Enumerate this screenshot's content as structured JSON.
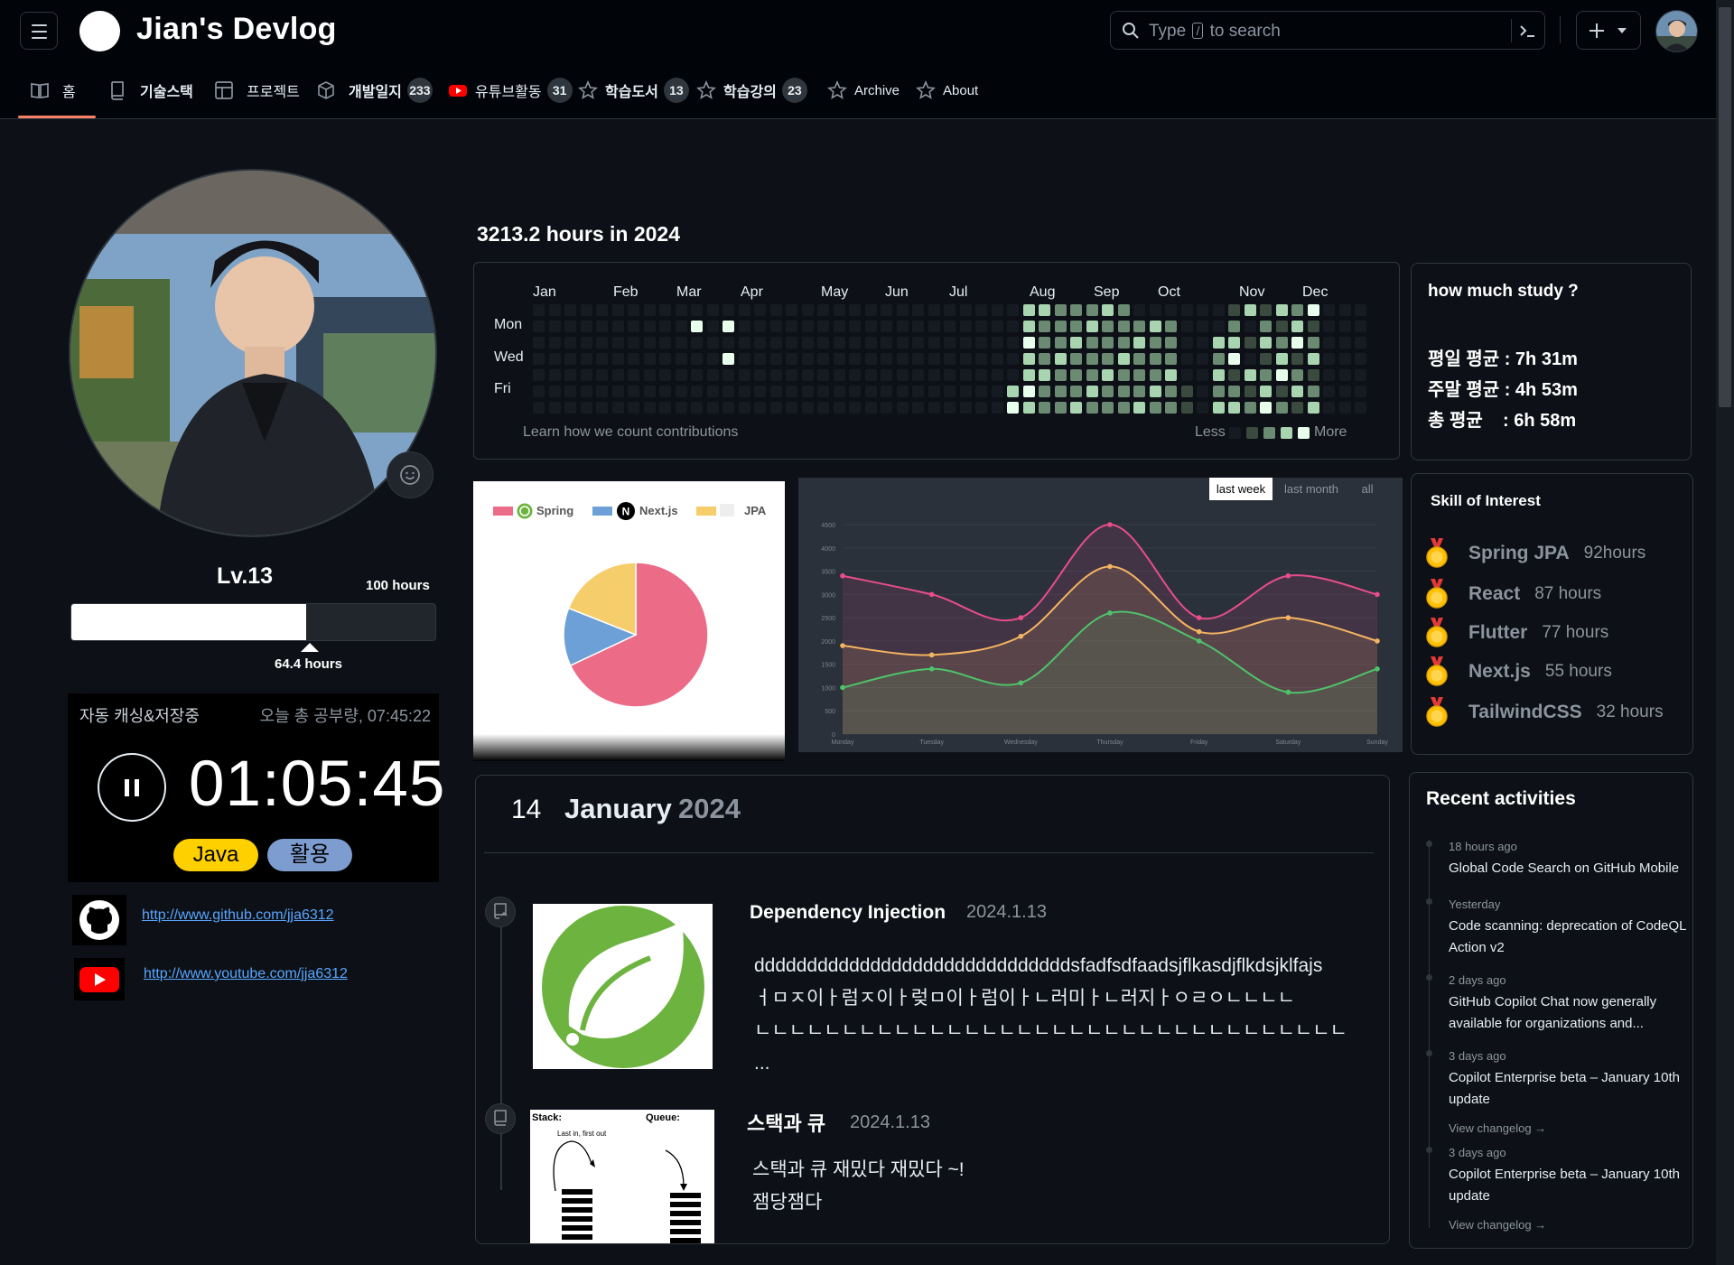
{
  "header": {
    "site_title": "Jian's Devlog",
    "search_placeholder_before": "Type",
    "search_placeholder_key": "/",
    "search_placeholder_after": "to search"
  },
  "nav": [
    {
      "label": "홈",
      "icon": "book-icon"
    },
    {
      "label": "기술스택",
      "icon": "repo-icon"
    },
    {
      "label": "프로젝트",
      "icon": "table-icon"
    },
    {
      "label": "개발일지",
      "icon": "package-icon",
      "count": "233"
    },
    {
      "label": "유튜브활동",
      "icon": "youtube-icon",
      "count": "31"
    },
    {
      "label": "학습도서",
      "icon": "star-icon",
      "count": "13"
    },
    {
      "label": "학습강의",
      "icon": "star-icon",
      "count": "23"
    },
    {
      "label": "Archive",
      "icon": "star-icon"
    },
    {
      "label": "About",
      "icon": "star-icon"
    }
  ],
  "profile": {
    "level": "Lv.13",
    "goal_label": "100 hours",
    "progress_fraction": 0.644,
    "progress_label": "64.4 hours"
  },
  "timer": {
    "autosave_label": "자동 캐싱&저장중",
    "today_total": "오늘 총 공부량, 07:45:22",
    "elapsed": "01:05:45",
    "tags": [
      "Java",
      "활용"
    ]
  },
  "links": {
    "github": "http://www.github.com/jja6312",
    "youtube": "http://www.youtube.com/jja6312"
  },
  "contributions": {
    "title": "3213.2 hours in 2024",
    "months": [
      "Jan",
      "Feb",
      "Mar",
      "Apr",
      "May",
      "Jun",
      "Jul",
      "Aug",
      "Sep",
      "Oct",
      "Nov",
      "Dec"
    ],
    "days": [
      "Mon",
      "Wed",
      "Fri"
    ],
    "footer_link": "Learn how we count contributions",
    "less": "Less",
    "more": "More",
    "colors": [
      "#161b22",
      "#3b4a3e",
      "#6b8a72",
      "#a9d4b0",
      "#e8ffec"
    ]
  },
  "pie_chart": {
    "legend": [
      "Spring",
      "Next.js",
      "JPA"
    ],
    "colors": [
      "#ec6c88",
      "#6ca0d6",
      "#f5cd6b"
    ],
    "values": [
      68,
      13,
      19
    ]
  },
  "line_chart": {
    "ranges": [
      "last week",
      "last month",
      "all"
    ],
    "active_range": "last week",
    "x": [
      "Monday",
      "Tuesday",
      "Wednesday",
      "Thursday",
      "Friday",
      "Saturday",
      "Sunday"
    ],
    "y_ticks": [
      "0",
      "500",
      "1000",
      "1500",
      "2000",
      "2500",
      "3000",
      "3500",
      "4000",
      "4500"
    ],
    "ylim": [
      0,
      4500
    ],
    "series": [
      {
        "color": "#e84d8a",
        "values": [
          3400,
          3000,
          2500,
          4500,
          2500,
          3400,
          3000
        ]
      },
      {
        "color": "#f5b461",
        "values": [
          1900,
          1700,
          2100,
          3600,
          2200,
          2500,
          2000
        ]
      },
      {
        "color": "#4fc36b",
        "values": [
          1000,
          1400,
          1100,
          2600,
          2000,
          900,
          1400
        ]
      }
    ]
  },
  "timeline": {
    "date_day": "14",
    "date_month": "January",
    "date_year": "2024",
    "posts": [
      {
        "title": "Dependency Injection",
        "date": "2024.1.13",
        "body": [
          "ddddddddddddddddddddddddddddddsfadfsdfaadsjflkasdjflkdsjklfajs",
          "ㅓㅁㅈ이ㅏ럼ㅈ이ㅏ렂ㅁ이ㅏ럼이ㅏㄴ러미ㅏㄴ러지ㅏㅇㄹㅇㄴㄴㄴㄴ",
          "ㄴㄴㄴㄴㄴㄴㄴㄴㄴㄴㄴㄴㄴㄴㄴㄴㄴㄴㄴㄴㄴㄴㄴㄴㄴㄴㄴㄴㄴㄴㄴㄴㄴㄴ",
          "..."
        ]
      },
      {
        "title": "스택과 큐",
        "date": "2024.1.13",
        "body": [
          "스택과 큐 재밌다 재밌다 ~!",
          "잼당잼다"
        ],
        "thumb_labels": [
          "Stack:",
          "Queue:",
          "Last in, first out"
        ]
      }
    ]
  },
  "study_stats": {
    "title": "how much study ?",
    "lines": [
      "평일 평균 : 7h 31m",
      "주말 평균 : 4h 53m",
      "총 평균    : 6h 58m"
    ]
  },
  "skills": {
    "title": "Skill of Interest",
    "items": [
      {
        "name": "Spring JPA",
        "hours": "92hours"
      },
      {
        "name": "React",
        "hours": "87 hours"
      },
      {
        "name": "Flutter",
        "hours": "77 hours"
      },
      {
        "name": "Next.js",
        "hours": "55 hours"
      },
      {
        "name": "TailwindCSS",
        "hours": "32 hours"
      }
    ]
  },
  "activities": {
    "title": "Recent activities",
    "items": [
      {
        "time": "18 hours ago",
        "text": "Global Code Search on GitHub Mobile"
      },
      {
        "time": "Yesterday",
        "text": "Code scanning: deprecation of CodeQL Action v2"
      },
      {
        "time": "2 days ago",
        "text": "GitHub Copilot Chat now generally available for organizations and..."
      },
      {
        "time": "3 days ago",
        "text": "Copilot Enterprise beta – January 10th update",
        "changelog": "View changelog →"
      },
      {
        "time": "3 days ago",
        "text": "Copilot Enterprise beta – January 10th update",
        "changelog": "View changelog →"
      }
    ]
  }
}
